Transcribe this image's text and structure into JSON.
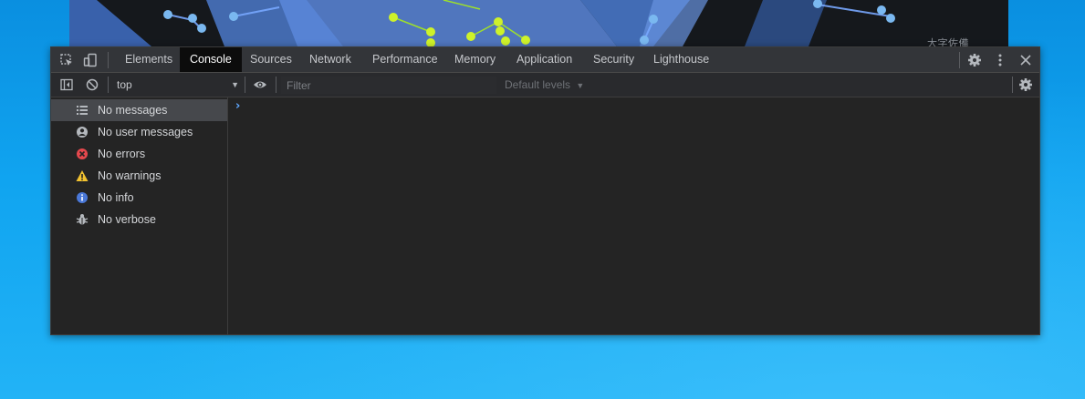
{
  "page": {
    "map_label": "大字佐備"
  },
  "devtools": {
    "tabs": [
      {
        "label": "Elements"
      },
      {
        "label": "Console"
      },
      {
        "label": "Sources"
      },
      {
        "label": "Network"
      },
      {
        "label": "Performance"
      },
      {
        "label": "Memory"
      },
      {
        "label": "Application"
      },
      {
        "label": "Security"
      },
      {
        "label": "Lighthouse"
      }
    ],
    "active_tab": "Console",
    "toolbar": {
      "context": "top",
      "filter_placeholder": "Filter",
      "levels": "Default levels"
    },
    "sidebar": {
      "items": [
        {
          "label": "No messages",
          "icon": "list-icon",
          "selected": true
        },
        {
          "label": "No user messages",
          "icon": "user-icon"
        },
        {
          "label": "No errors",
          "icon": "error-icon",
          "color": "#e5484d"
        },
        {
          "label": "No warnings",
          "icon": "warning-icon",
          "color": "#f2c230"
        },
        {
          "label": "No info",
          "icon": "info-icon",
          "color": "#4a78d8"
        },
        {
          "label": "No verbose",
          "icon": "bug-icon"
        }
      ]
    },
    "prompt_symbol": "›"
  }
}
